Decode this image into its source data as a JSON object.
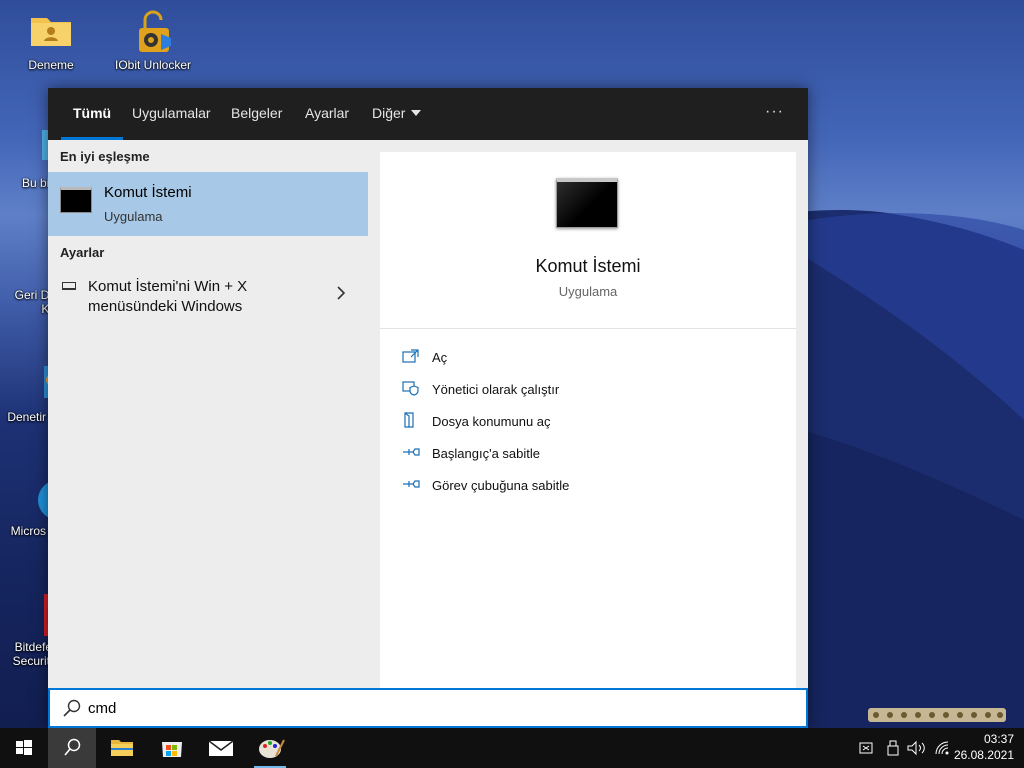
{
  "desktop": {
    "icons": [
      {
        "label": "Deneme"
      },
      {
        "label": "IObit Unlocker"
      },
      {
        "label": "Bu bil"
      },
      {
        "label": "Geri Do\nKu"
      },
      {
        "label": "Denetir"
      },
      {
        "label": "Micros"
      },
      {
        "label": "Bitdefer\nSecurity"
      }
    ]
  },
  "search_panel": {
    "tabs": [
      {
        "label": "Tümü",
        "active": true
      },
      {
        "label": "Uygulamalar"
      },
      {
        "label": "Belgeler"
      },
      {
        "label": "Ayarlar"
      },
      {
        "label": "Diğer"
      }
    ],
    "more_label": "···",
    "best_match_header": "En iyi eşleşme",
    "best_match": {
      "title": "Komut İstemi",
      "subtitle": "Uygulama"
    },
    "settings_header": "Ayarlar",
    "settings_item": {
      "line1": "Komut İstemi'ni Win + X",
      "line2": "menüsündeki Windows"
    },
    "detail": {
      "title": "Komut İstemi",
      "type": "Uygulama",
      "actions": [
        {
          "label": "Aç",
          "icon": "open-icon"
        },
        {
          "label": "Yönetici olarak çalıştır",
          "icon": "shield-icon"
        },
        {
          "label": "Dosya konumunu aç",
          "icon": "file-location-icon"
        },
        {
          "label": "Başlangıç'a sabitle",
          "icon": "pin-icon"
        },
        {
          "label": "Görev çubuğuna sabitle",
          "icon": "pin-icon"
        }
      ]
    }
  },
  "search": {
    "value": "cmd"
  },
  "taskbar": {
    "time": "03:37",
    "date": "26.08.2021"
  },
  "colors": {
    "accent": "#0078d7",
    "selected": "#a7c8e6",
    "topbar": "#1f1f1f"
  }
}
